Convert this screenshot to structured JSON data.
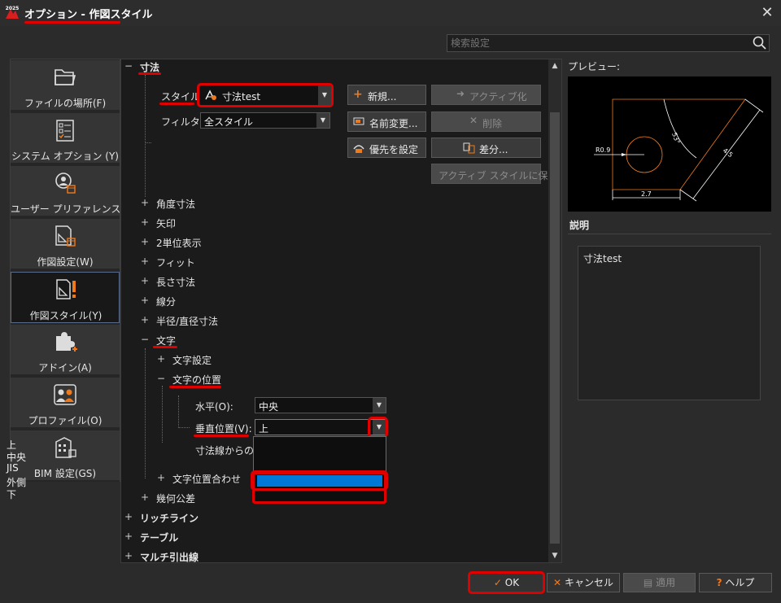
{
  "window": {
    "badge": "2025",
    "title": "オプション - 作図スタイル",
    "close_label": "✕"
  },
  "search": {
    "placeholder": "検索設定"
  },
  "nav": {
    "items": [
      {
        "label": "ファイルの場所(F)",
        "icon": "folder-icon"
      },
      {
        "label": "システム オプション (Y)",
        "icon": "checklist-icon"
      },
      {
        "label": "ユーザー プリファレンス(U)",
        "icon": "user-settings-icon"
      },
      {
        "label": "作図設定(W)",
        "icon": "drawing-settings-icon"
      },
      {
        "label": "作図スタイル(Y)",
        "icon": "drawing-style-icon",
        "active": true
      },
      {
        "label": "アドイン(A)",
        "icon": "puzzle-icon"
      },
      {
        "label": "プロファイル(O)",
        "icon": "profile-icon"
      },
      {
        "label": "BIM 設定(GS)",
        "icon": "building-icon"
      }
    ]
  },
  "tree": {
    "dimension": {
      "toggle": "−",
      "label": "寸法"
    },
    "style_label": "スタイル:",
    "style_value": "寸法test",
    "filter_label": "フィルタ:",
    "filter_value": "全スタイル",
    "buttons": {
      "new": "新規...",
      "activate": "アクティブ化",
      "rename": "名前変更...",
      "delete": "削除",
      "priority": "優先を設定",
      "diff": "差分...",
      "save_active": "アクティブ スタイルに保存"
    },
    "dim_children": [
      {
        "toggle": "+",
        "label": "角度寸法"
      },
      {
        "toggle": "+",
        "label": "矢印"
      },
      {
        "toggle": "+",
        "label": "2単位表示"
      },
      {
        "toggle": "+",
        "label": "フィット"
      },
      {
        "toggle": "+",
        "label": "長さ寸法"
      },
      {
        "toggle": "+",
        "label": "線分"
      },
      {
        "toggle": "+",
        "label": "半径/直径寸法"
      }
    ],
    "text": {
      "toggle": "−",
      "label": "文字"
    },
    "text_settings": {
      "toggle": "+",
      "label": "文字設定"
    },
    "text_position": {
      "toggle": "−",
      "label": "文字の位置"
    },
    "horizontal_label": "水平(O):",
    "horizontal_value": "中央",
    "vertical_label": "垂直位置(V):",
    "vertical_value": "上",
    "offset_label": "寸法線からのオ",
    "vertical_options": [
      "上",
      "中央",
      "JIS",
      "外側",
      "下"
    ],
    "vertical_selected": "外側",
    "text_align": {
      "toggle": "+",
      "label": "文字位置合わせ"
    },
    "tolerance": {
      "toggle": "+",
      "label": "幾何公差"
    },
    "top_items": [
      {
        "toggle": "+",
        "label": "リッチライン"
      },
      {
        "toggle": "+",
        "label": "テーブル"
      },
      {
        "toggle": "+",
        "label": "マルチ引出線"
      }
    ]
  },
  "preview": {
    "label": "プレビュー:",
    "dims": {
      "radius": "R0.9",
      "width": "2.7",
      "slant": "4.5",
      "angle": "53°"
    }
  },
  "description": {
    "label": "説明",
    "text": "寸法test"
  },
  "footer": {
    "ok": "OK",
    "cancel": "キャンセル",
    "apply": "適用",
    "help": "ヘルプ"
  },
  "colors": {
    "highlight": "#e10000",
    "selection": "#0078d7",
    "accent": "#f07a1a"
  }
}
